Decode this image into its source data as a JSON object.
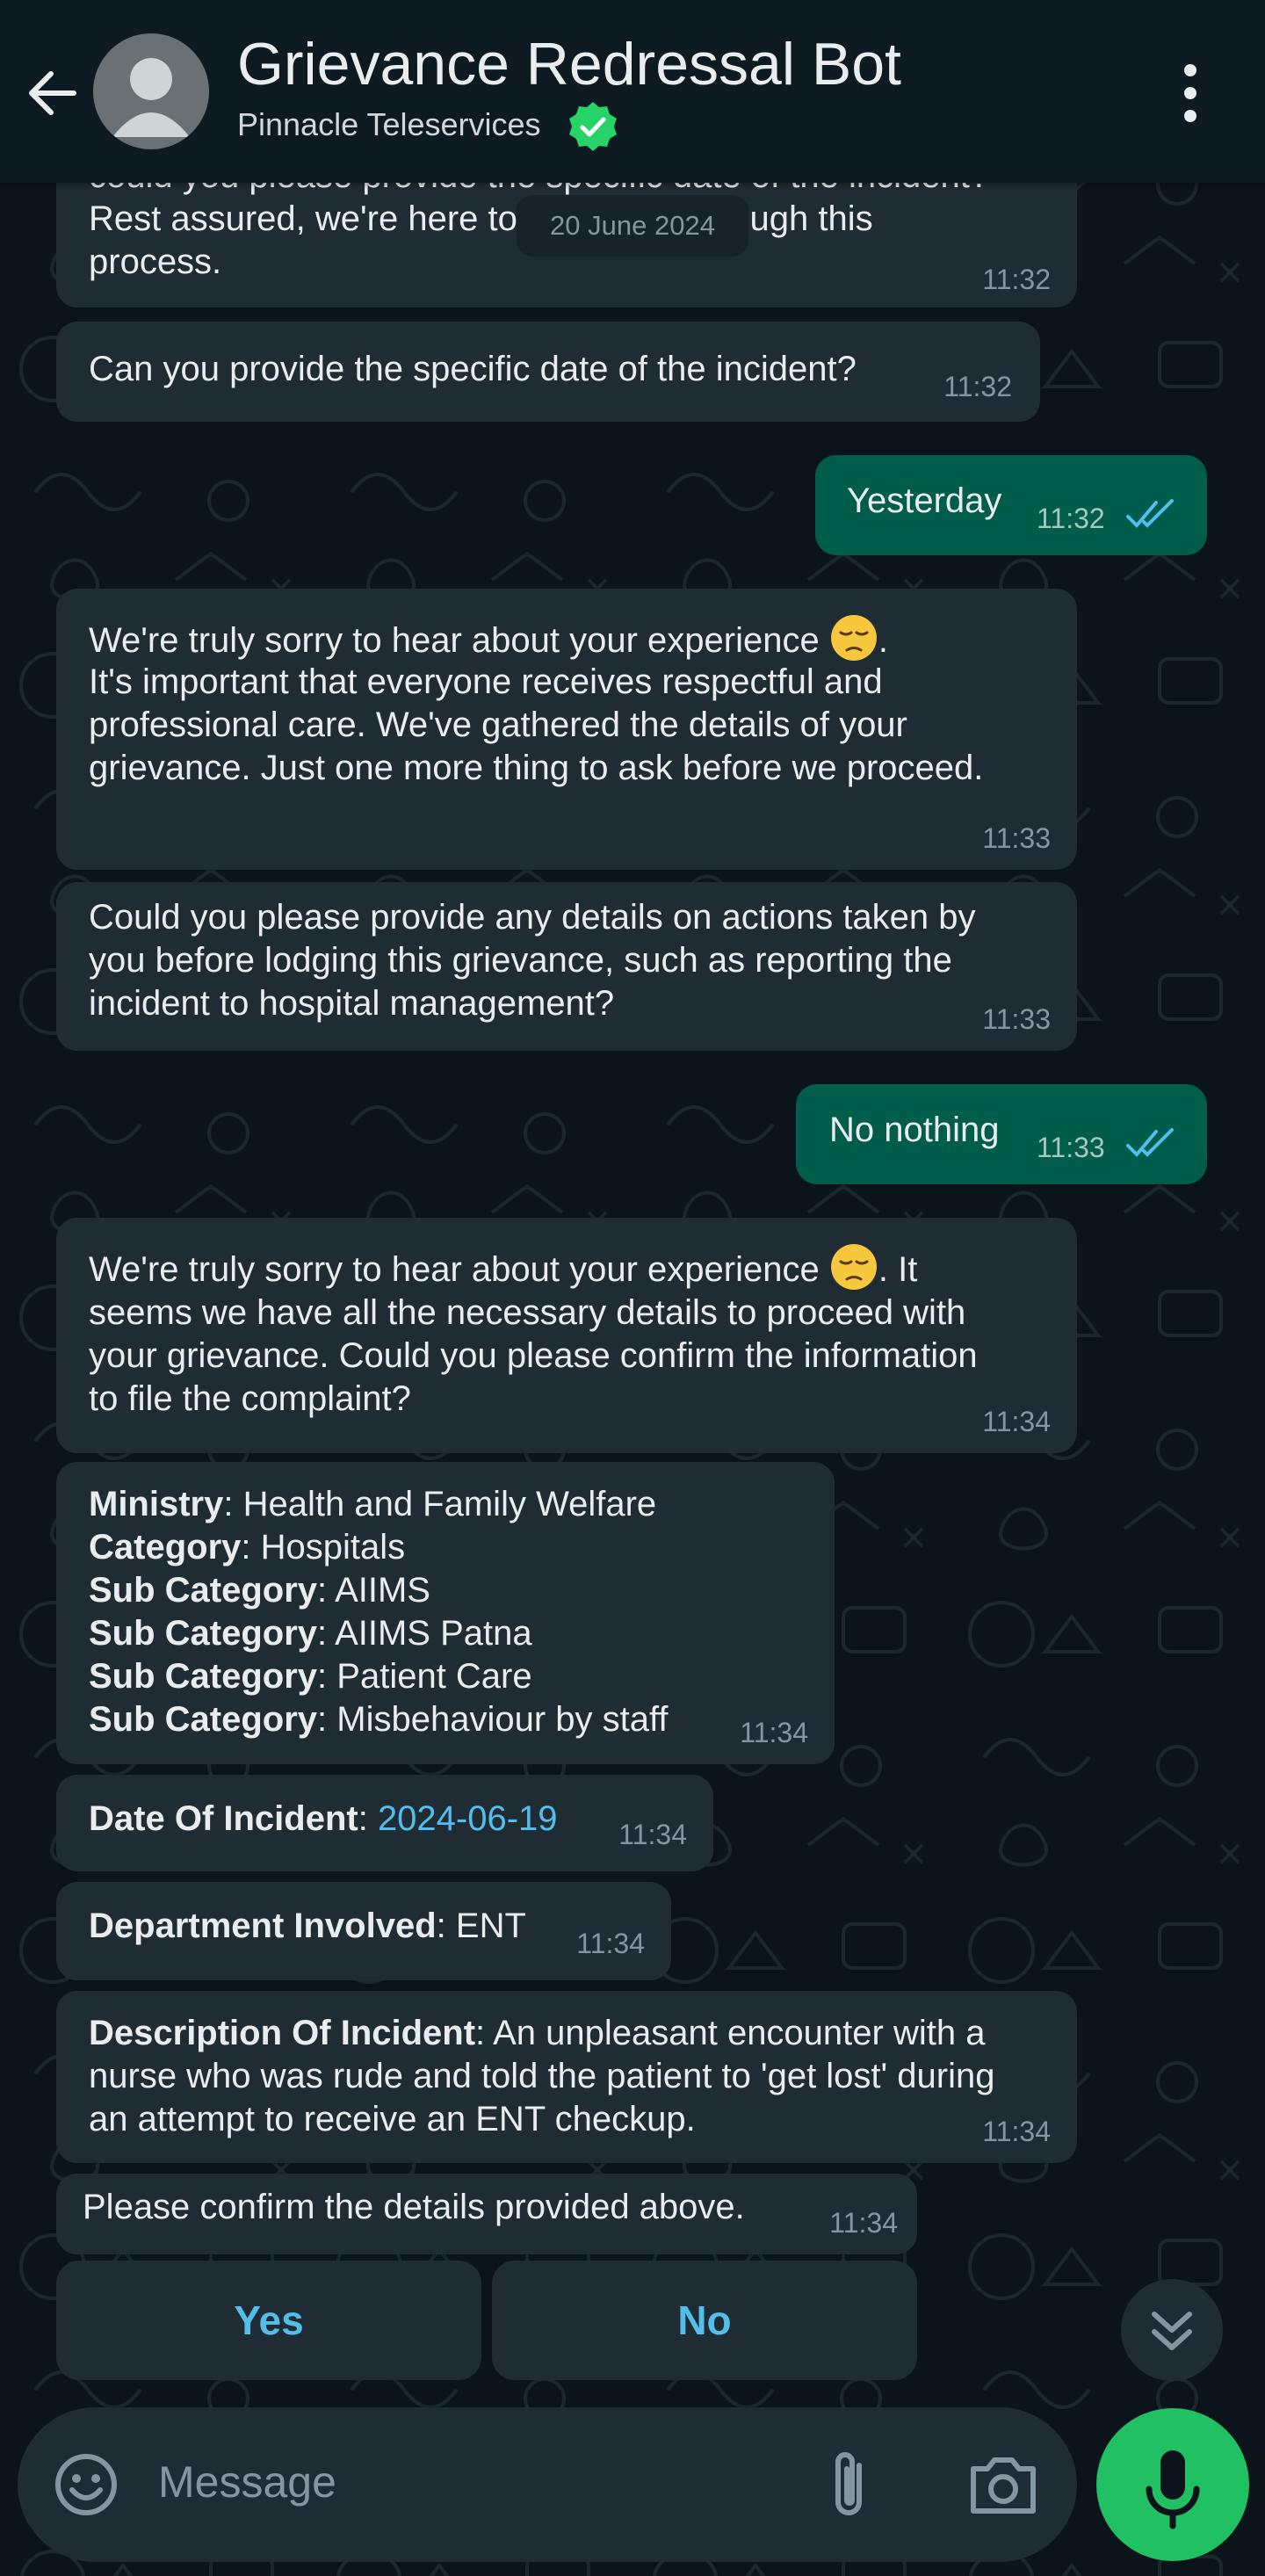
{
  "header": {
    "title": "Grievance Redressal Bot",
    "subtitle": "Pinnacle Teleservices"
  },
  "date_chip": "20 June 2024",
  "messages": [
    {
      "direction": "in",
      "lines": [
        "could you please provide the specific date of the incident?",
        "Rest assured, we're here to guide you through this",
        "process."
      ],
      "time": "11:32"
    },
    {
      "direction": "in",
      "text": "Can you provide the specific date of the incident?",
      "time": "11:32"
    },
    {
      "direction": "out",
      "text": "Yesterday",
      "time": "11:32"
    },
    {
      "direction": "in",
      "line1": "We're truly sorry to hear about your experience",
      "line1_end": ".",
      "lines": [
        "It's important that everyone receives respectful and",
        "professional care. We've gathered the details of your",
        "grievance. Just one more thing to ask before we proceed."
      ],
      "time": "11:33"
    },
    {
      "direction": "in",
      "lines": [
        "Could you please provide any details on actions taken by",
        "you before lodging this grievance, such as reporting the",
        "incident to hospital management?"
      ],
      "time": "11:33"
    },
    {
      "direction": "out",
      "text": "No nothing",
      "time": "11:33"
    },
    {
      "direction": "in",
      "line1": "We're truly sorry to hear about your experience",
      "line1_end": ". It",
      "lines": [
        "seems we have all the necessary details to proceed with",
        "your grievance. Could you please confirm the information",
        "to file the complaint?"
      ],
      "time": "11:34"
    },
    {
      "direction": "in",
      "fields": [
        {
          "label": "Ministry",
          "value": ": Health and Family Welfare"
        },
        {
          "label": "Category",
          "value": ": Hospitals"
        },
        {
          "label": "Sub Category",
          "value": ": AIIMS"
        },
        {
          "label": "Sub Category",
          "value": ": AIIMS Patna"
        },
        {
          "label": "Sub Category",
          "value": ": Patient Care"
        },
        {
          "label": "Sub Category",
          "value": ": Misbehaviour by staff"
        }
      ],
      "time": "11:34"
    },
    {
      "direction": "in",
      "label": "Date Of Incident",
      "sep": ": ",
      "value": "2024-06-19",
      "time": "11:34"
    },
    {
      "direction": "in",
      "label": "Department Involved",
      "value": ": ENT",
      "time": "11:34"
    },
    {
      "direction": "in",
      "label": "Description Of Incident",
      "value": ": An unpleasant encounter with a",
      "lines": [
        "nurse who was rude and told the patient to 'get lost' during",
        "an attempt to receive an ENT checkup."
      ],
      "time": "11:34"
    },
    {
      "direction": "in",
      "text": "Please confirm the details provided above.",
      "time": "11:34"
    }
  ],
  "quick_replies": {
    "yes": "Yes",
    "no": "No"
  },
  "composer": {
    "placeholder": "Message"
  },
  "icons": [
    "back-arrow-icon",
    "default-avatar-icon",
    "verified-badge-icon",
    "more-vert-icon",
    "double-check-icon",
    "pensive-face-emoji",
    "double-chevron-down-icon",
    "emoji-icon",
    "attach-icon",
    "camera-icon",
    "mic-icon"
  ],
  "colors": {
    "background": "#0b141a",
    "header": "#0e1a21",
    "incoming": "#202c33",
    "outgoing": "#005c4b",
    "accent": "#53bdeb",
    "green": "#21c063"
  }
}
